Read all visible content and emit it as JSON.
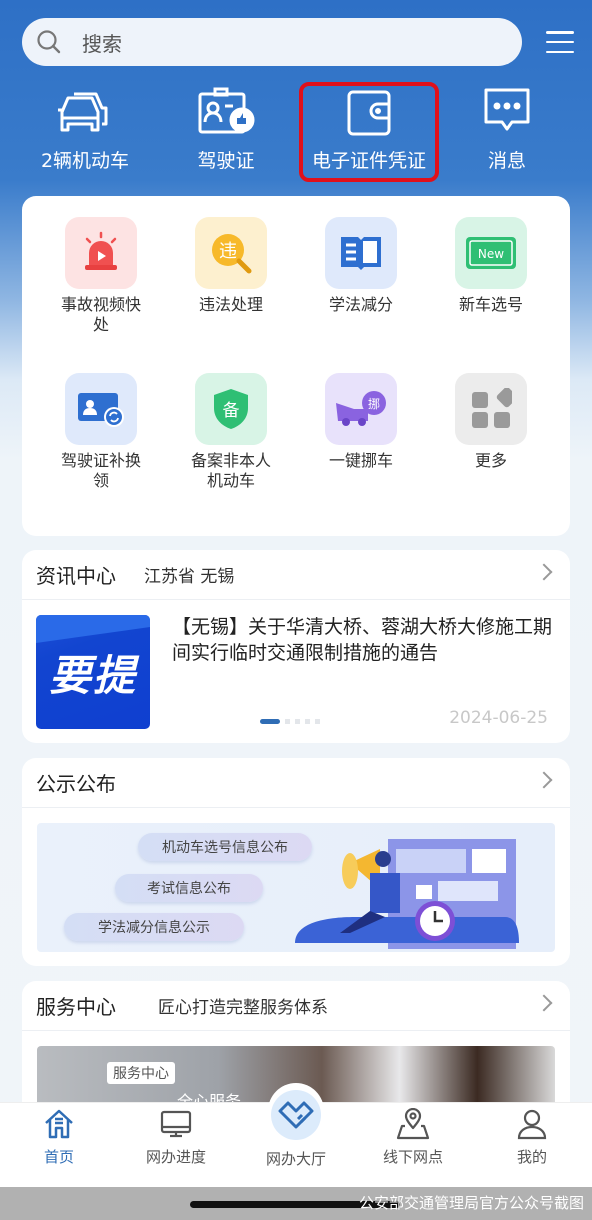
{
  "search": {
    "placeholder": "搜索",
    "icon": "search-icon"
  },
  "header_menu": {
    "icon": "hamburger-menu-icon"
  },
  "quick_actions": [
    {
      "label": "2辆机动车",
      "icon": "car-icon"
    },
    {
      "label": "驾驶证",
      "icon": "license-card-icon"
    },
    {
      "label": "电子证件凭证",
      "icon": "wallet-icon",
      "highlighted": true
    },
    {
      "label": "消息",
      "icon": "message-icon"
    }
  ],
  "services": [
    {
      "label": "事故视频快处",
      "icon": "alarm-video-icon"
    },
    {
      "label": "违法处理",
      "icon": "violation-icon"
    },
    {
      "label": "学法减分",
      "icon": "book-icon"
    },
    {
      "label": "新车选号",
      "icon": "new-plate-icon",
      "badge": "New"
    },
    {
      "label": "驾驶证补换领",
      "icon": "license-replace-icon"
    },
    {
      "label": "备案非本人机动车",
      "icon": "record-shield-icon",
      "badge": "备"
    },
    {
      "label": "一键挪车",
      "icon": "tow-truck-icon",
      "badge": "挪"
    },
    {
      "label": "更多",
      "icon": "more-grid-icon"
    }
  ],
  "news": {
    "title": "资讯中心",
    "location": "江苏省 无锡",
    "thumb_text": "要提",
    "headline": "【无锡】关于华清大桥、蓉湖大桥大修施工期间实行临时交通限制措施的通告",
    "date": "2024-06-25",
    "carousel_pages": 5,
    "carousel_active": 1
  },
  "notice": {
    "title": "公示公布",
    "pills": [
      "机动车选号信息公布",
      "考试信息公布",
      "学法减分信息公示"
    ]
  },
  "service_center": {
    "title": "服务中心",
    "subtitle": "匠心打造完整服务体系",
    "banner_tag": "服务中心",
    "banner_text": "全心服务"
  },
  "tabbar": [
    {
      "label": "首页",
      "icon": "home-icon",
      "active": true
    },
    {
      "label": "网办进度",
      "icon": "monitor-icon"
    },
    {
      "label": "网办大厅",
      "icon": "handshake-heart-icon"
    },
    {
      "label": "线下网点",
      "icon": "map-pin-icon"
    },
    {
      "label": "我的",
      "icon": "user-icon"
    }
  ],
  "watermark": "公安部交通管理局官方公众号截图",
  "colors": {
    "primary": "#2e70c6",
    "highlight": "#e0101a",
    "active_tab": "#2f6db5"
  }
}
